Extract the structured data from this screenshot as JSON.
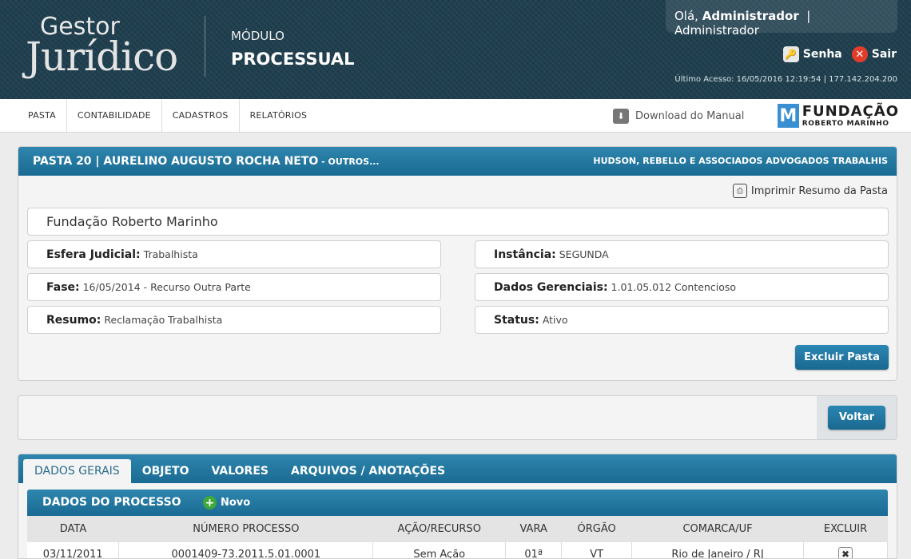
{
  "header": {
    "logo_top": "Gestor",
    "logo_main": "Jurídico",
    "module_label": "MÓDULO",
    "module_name": "PROCESSUAL",
    "greeting": "Olá,",
    "user_name": "Administrador",
    "user_role": "Administrador",
    "password_link": "Senha",
    "logout_link": "Sair",
    "last_access": "Último Acesso: 16/05/2016 12:19:54 | 177.142.204.200"
  },
  "nav": {
    "items": [
      "PASTA",
      "CONTABILIDADE",
      "CADASTROS",
      "RELATÓRIOS"
    ],
    "download_manual": "Download do Manual",
    "brand_mark": "M",
    "brand_line1": "FUNDAÇÃO",
    "brand_line2": "ROBERTO MARINHO"
  },
  "pasta": {
    "title": "PASTA 20 | AURELINO AUGUSTO ROCHA NETO",
    "title_suffix": " - OUTROS...",
    "firm": "HUDSON, REBELLO E ASSOCIADOS ADVOGADOS TRABALHIS",
    "print_label": "Imprimir Resumo da Pasta",
    "client": "Fundação Roberto Marinho",
    "esfera_label": "Esfera Judicial:",
    "esfera_value": "Trabalhista",
    "instancia_label": "Instância:",
    "instancia_value": "SEGUNDA",
    "fase_label": "Fase:",
    "fase_value": "16/05/2014 - Recurso Outra Parte",
    "dados_label": "Dados Gerenciais:",
    "dados_value": "1.01.05.012 Contencioso",
    "resumo_label": "Resumo:",
    "resumo_value": "Reclamação Trabalhista",
    "status_label": "Status:",
    "status_value": "Ativo",
    "delete_button": "Excluir Pasta"
  },
  "back_button": "Voltar",
  "tabs": [
    "DADOS GERAIS",
    "OBJETO",
    "VALORES",
    "ARQUIVOS / ANOTAÇÕES"
  ],
  "processo": {
    "title": "DADOS DO PROCESSO",
    "new_label": "Novo",
    "columns": [
      "DATA",
      "NÚMERO PROCESSO",
      "AÇÃO/RECURSO",
      "VARA",
      "ÓRGÃO",
      "COMARCA/UF",
      "EXCLUIR"
    ],
    "rows": [
      [
        "03/11/2011",
        "0001409-73.2011.5.01.0001",
        "Sem Ação",
        "01ª",
        "VT",
        "Rio de Janeiro / RJ"
      ]
    ]
  }
}
